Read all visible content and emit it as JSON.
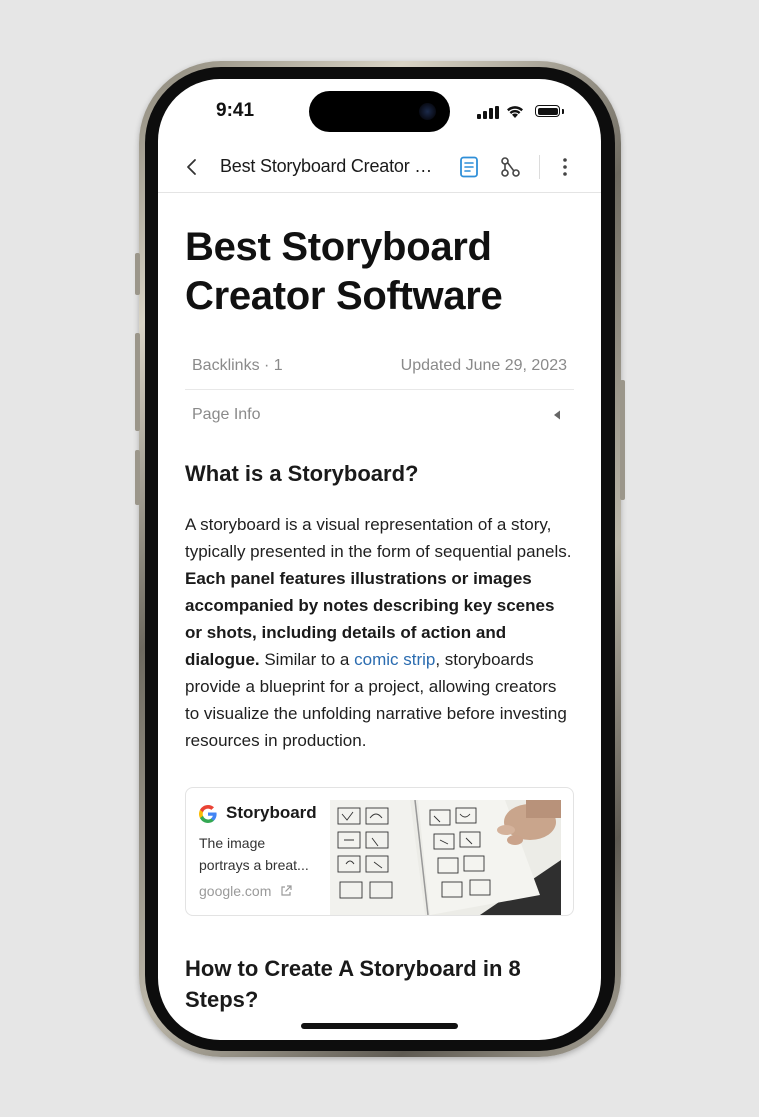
{
  "status_bar": {
    "time": "9:41"
  },
  "nav": {
    "title": "Best Storyboard Creator Software",
    "back_icon": "chevron-left-icon",
    "doc_icon": "document-icon",
    "share_icon": "graph-icon",
    "more_icon": "more-vertical-icon",
    "accent_color": "#2f8fd8"
  },
  "page": {
    "title_line1": "Best Storyboard",
    "title_line2": "Creator Software",
    "backlinks": "Backlinks · 1",
    "updated": "Updated June 29, 2023",
    "page_info": "Page Info"
  },
  "section1": {
    "heading": "What is a Storyboard?",
    "p_intro": "A storyboard is a visual representation of a story, typically presented in the form of sequential panels. ",
    "p_bold": "Each panel features illustrations or images accompanied by notes describing key scenes or shots, including details of action and dialogue.",
    "p_mid": " Similar to a ",
    "p_link": "comic strip",
    "p_end": ", storyboards provide a blueprint for a project, allowing creators to visualize the unfolding narrative before investing resources in production.",
    "link_color": "#2b6cb0"
  },
  "card": {
    "title": "Storyboard",
    "desc_line1": "The image",
    "desc_line2": "portrays a breat...",
    "source": "google.com",
    "icon": "google-icon",
    "image": "storyboard-sketch-image"
  },
  "section2": {
    "heading": "How to Create A Storyboard in 8 Steps?"
  }
}
